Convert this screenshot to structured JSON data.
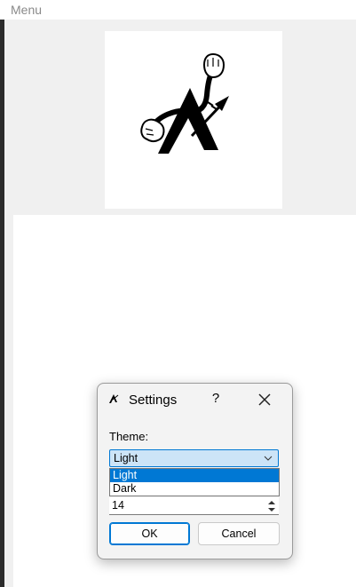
{
  "window": {
    "menu_label": "Menu"
  },
  "dialog": {
    "title": "Settings",
    "help_label": "?",
    "theme_label": "Theme:",
    "theme_selected": "Light",
    "theme_options": [
      "Light",
      "Dark"
    ],
    "font_size_value": "14",
    "ok_label": "OK",
    "cancel_label": "Cancel"
  },
  "colors": {
    "accent": "#0078d4",
    "combo_fill": "#cce4f7",
    "dialog_bg": "#f3f3f3"
  },
  "icons": [
    "app-logo-icon",
    "close-icon",
    "chevron-down-icon",
    "spin-up-icon",
    "spin-down-icon"
  ]
}
